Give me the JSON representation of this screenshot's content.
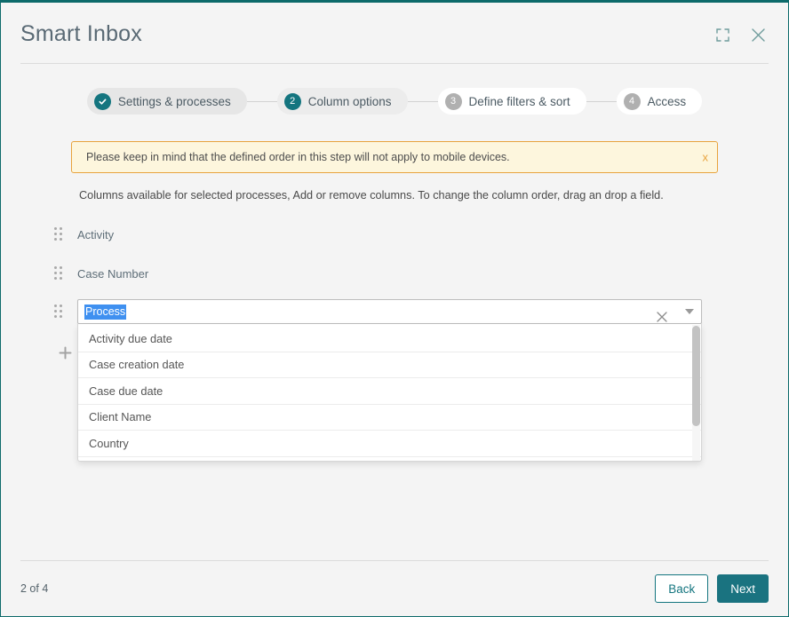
{
  "window": {
    "title": "Smart Inbox",
    "expand_icon": "expand-icon",
    "close_icon": "close-icon"
  },
  "stepper": {
    "steps": [
      {
        "badge": "check",
        "label": "Settings & processes",
        "state": "done"
      },
      {
        "badge": "2",
        "label": "Column options",
        "state": "current"
      },
      {
        "badge": "3",
        "label": "Define filters & sort",
        "state": "upcoming"
      },
      {
        "badge": "4",
        "label": "Access",
        "state": "upcoming"
      }
    ]
  },
  "banner": {
    "text": "Please keep in mind that the defined order in this step will not apply to mobile devices.",
    "close_label": "x",
    "border_color": "#e8a33d",
    "background_color": "#fdf6dd"
  },
  "helper_text": "Columns available for selected processes, Add or remove columns. To change the column order, drag an drop a field.",
  "columns": [
    {
      "name": "Activity"
    },
    {
      "name": "Case Number"
    }
  ],
  "combobox": {
    "value": "Process",
    "caret_icon": "chevron-down-icon",
    "remove_icon": "close-icon",
    "options": [
      "Activity due date",
      "Case creation date",
      "Case due date",
      "Client Name",
      "Country"
    ]
  },
  "add_button": {
    "icon": "plus-icon"
  },
  "footer": {
    "page_count": "2 of 4",
    "back_label": "Back",
    "next_label": "Next"
  },
  "theme": {
    "accent": "#1a7380",
    "accent_dark": "#0d6a6a",
    "selection_blue": "#3f90f0"
  }
}
